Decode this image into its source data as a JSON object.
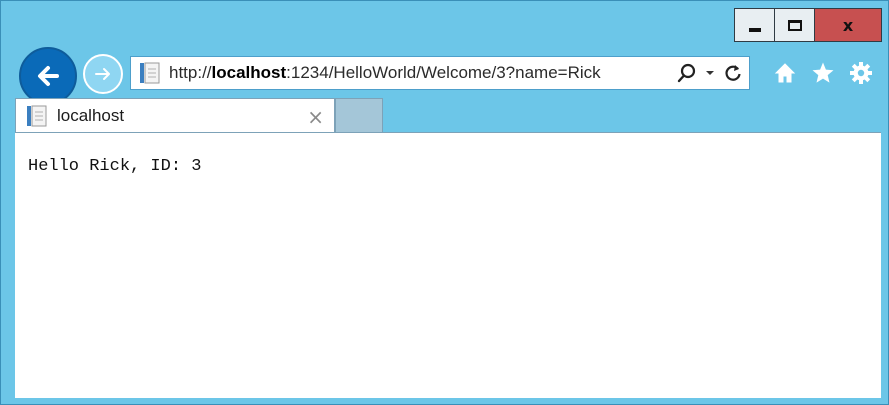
{
  "window": {
    "minimize_icon": "minimize-icon",
    "maximize_icon": "maximize-icon",
    "close_glyph": "x"
  },
  "nav": {
    "back_icon": "back-arrow-icon",
    "forward_icon": "forward-arrow-icon"
  },
  "address": {
    "prefix": "http://",
    "host": "localhost",
    "rest": ":1234/HelloWorld/Welcome/3?name=Rick"
  },
  "toolbar": {
    "home_icon": "home-icon",
    "favorites_icon": "star-icon",
    "settings_icon": "gear-icon"
  },
  "tab": {
    "title": "localhost",
    "close_glyph": "×"
  },
  "page": {
    "text": "Hello Rick, ID: 3"
  },
  "colors": {
    "frame": "#6cc6e8",
    "back_button": "#0a6ab8",
    "close_button": "#c75050"
  }
}
